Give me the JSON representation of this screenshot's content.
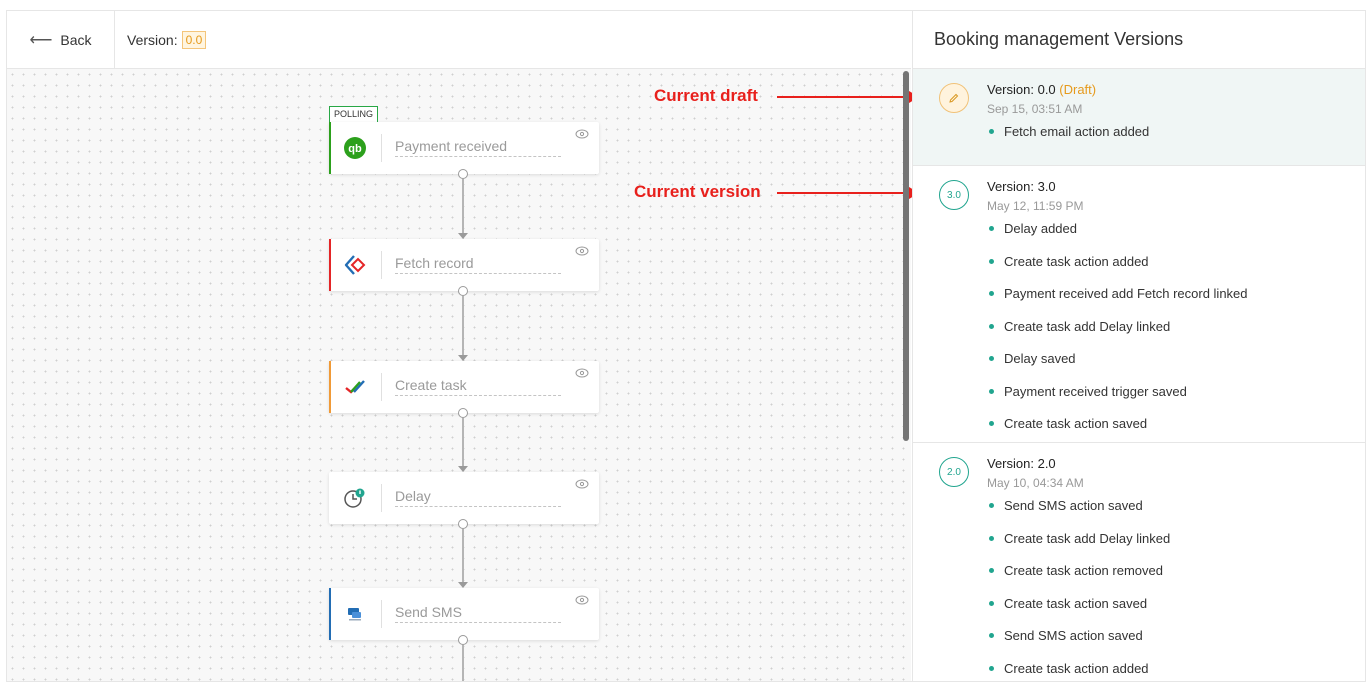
{
  "header": {
    "back_label": "Back",
    "version_label": "Version:",
    "version_value": "0.0"
  },
  "canvas": {
    "polling_tag": "POLLING",
    "nodes": [
      {
        "name": "Payment received",
        "icon": "quickbooks-icon",
        "accent": "#2ca01c"
      },
      {
        "name": "Fetch record",
        "icon": "zoho-creator-icon",
        "accent": "#e42527"
      },
      {
        "name": "Create task",
        "icon": "checkmark-task-icon",
        "accent": "#f09a37"
      },
      {
        "name": "Delay",
        "icon": "clock-delay-icon",
        "accent": ""
      },
      {
        "name": "Send SMS",
        "icon": "sms-chat-icon",
        "accent": "#226db4"
      }
    ],
    "annotations": {
      "current_draft": "Current draft",
      "current_version": "Current version"
    }
  },
  "panel": {
    "title": "Booking management Versions",
    "versions": [
      {
        "badge": "",
        "title": "Version: 0.0",
        "draft_tag": "(Draft)",
        "date": "Sep 15, 03:51 AM",
        "changes": [
          "Fetch email action added"
        ]
      },
      {
        "badge": "3.0",
        "title": "Version: 3.0",
        "draft_tag": "",
        "date": "May 12, 11:59 PM",
        "changes": [
          "Delay added",
          "Create task action added",
          "Payment received add Fetch record linked",
          "Create task add Delay linked",
          "Delay saved",
          "Payment received trigger saved",
          "Create task action saved"
        ]
      },
      {
        "badge": "2.0",
        "title": "Version: 2.0",
        "draft_tag": "",
        "date": "May 10, 04:34 AM",
        "changes": [
          "Send SMS action saved",
          "Create task add Delay linked",
          "Create task action removed",
          "Create task action saved",
          "Send SMS action saved",
          "Create task action added"
        ]
      }
    ]
  },
  "colors": {
    "accent_teal": "#21a58f",
    "draft_orange": "#e69a1c",
    "annotation_red": "#e8201c"
  }
}
